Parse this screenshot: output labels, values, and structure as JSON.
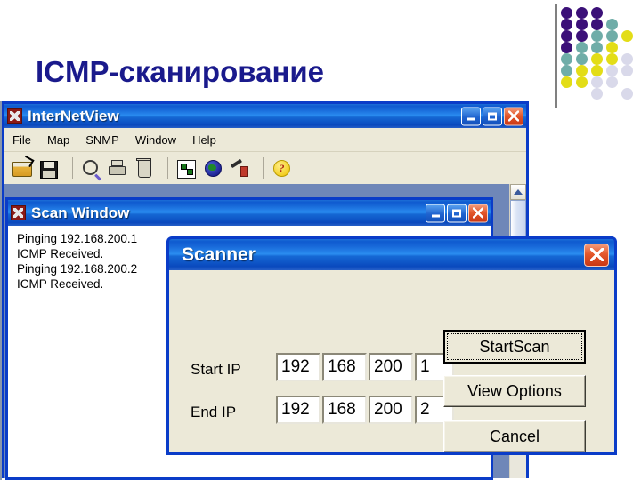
{
  "slide": {
    "title": "ICMP-сканирование",
    "title_color": "#1a1a8c"
  },
  "decoration": {
    "name": "dot-grid",
    "divider_color": "#808080",
    "colors": {
      "purple": "#3b1078",
      "teal": "#6fada8",
      "yellow": "#e3dd17",
      "lavender": "#d9d9ea"
    },
    "dots": [
      {
        "col": 0,
        "row": 0,
        "color": "#3b1078"
      },
      {
        "col": 1,
        "row": 0,
        "color": "#3b1078"
      },
      {
        "col": 2,
        "row": 0,
        "color": "#3b1078"
      },
      {
        "col": 0,
        "row": 1,
        "color": "#3b1078"
      },
      {
        "col": 1,
        "row": 1,
        "color": "#3b1078"
      },
      {
        "col": 2,
        "row": 1,
        "color": "#3b1078"
      },
      {
        "col": 3,
        "row": 1,
        "color": "#6fada8"
      },
      {
        "col": 0,
        "row": 2,
        "color": "#3b1078"
      },
      {
        "col": 1,
        "row": 2,
        "color": "#3b1078"
      },
      {
        "col": 2,
        "row": 2,
        "color": "#6fada8"
      },
      {
        "col": 3,
        "row": 2,
        "color": "#6fada8"
      },
      {
        "col": 4,
        "row": 2,
        "color": "#e3dd17"
      },
      {
        "col": 0,
        "row": 3,
        "color": "#3b1078"
      },
      {
        "col": 1,
        "row": 3,
        "color": "#6fada8"
      },
      {
        "col": 2,
        "row": 3,
        "color": "#6fada8"
      },
      {
        "col": 3,
        "row": 3,
        "color": "#e3dd17"
      },
      {
        "col": 0,
        "row": 4,
        "color": "#6fada8"
      },
      {
        "col": 1,
        "row": 4,
        "color": "#6fada8"
      },
      {
        "col": 2,
        "row": 4,
        "color": "#e3dd17"
      },
      {
        "col": 3,
        "row": 4,
        "color": "#e3dd17"
      },
      {
        "col": 4,
        "row": 4,
        "color": "#d9d9ea"
      },
      {
        "col": 0,
        "row": 5,
        "color": "#6fada8"
      },
      {
        "col": 1,
        "row": 5,
        "color": "#e3dd17"
      },
      {
        "col": 2,
        "row": 5,
        "color": "#e3dd17"
      },
      {
        "col": 3,
        "row": 5,
        "color": "#d9d9ea"
      },
      {
        "col": 4,
        "row": 5,
        "color": "#d9d9ea"
      },
      {
        "col": 0,
        "row": 6,
        "color": "#e3dd17"
      },
      {
        "col": 1,
        "row": 6,
        "color": "#e3dd17"
      },
      {
        "col": 2,
        "row": 6,
        "color": "#d9d9ea"
      },
      {
        "col": 3,
        "row": 6,
        "color": "#d9d9ea"
      },
      {
        "col": 2,
        "row": 7,
        "color": "#d9d9ea"
      },
      {
        "col": 4,
        "row": 7,
        "color": "#d9d9ea"
      }
    ]
  },
  "internetview": {
    "title": "InterNetView",
    "app_icon": "internetview-app-icon",
    "window_buttons": {
      "minimize": "minimize-button",
      "maximize": "maximize-button",
      "close": "close-button"
    },
    "menu": [
      {
        "label": "File"
      },
      {
        "label": "Map"
      },
      {
        "label": "SNMP"
      },
      {
        "label": "Window"
      },
      {
        "label": "Help"
      }
    ],
    "toolbar": [
      {
        "icon": "open-folder-icon",
        "tip": "Open"
      },
      {
        "icon": "save-disk-icon",
        "tip": "Save"
      },
      {
        "icon": "search-magnifier-icon",
        "tip": "Find"
      },
      {
        "icon": "print-icon",
        "tip": "Print"
      },
      {
        "icon": "delete-trash-icon",
        "tip": "Delete"
      },
      {
        "icon": "network-map-icon",
        "tip": "Map"
      },
      {
        "icon": "globe-icon",
        "tip": "Internet"
      },
      {
        "icon": "tools-icon",
        "tip": "Tools"
      },
      {
        "icon": "help-question-icon",
        "tip": "Help"
      }
    ],
    "scrollbar": {
      "up_arrow": "scroll-up-arrow"
    }
  },
  "scanwindow": {
    "title": "Scan Window",
    "app_icon": "scanwindow-app-icon",
    "log": [
      "Pinging 192.168.200.1",
      "ICMP Received.",
      "Pinging 192.168.200.2",
      "ICMP Received."
    ]
  },
  "scanner": {
    "title": "Scanner",
    "close_label": "close-button",
    "fields": [
      {
        "label": "Start IP",
        "octets": [
          "192",
          "168",
          "200",
          "1"
        ]
      },
      {
        "label": "End IP",
        "octets": [
          "192",
          "168",
          "200",
          "2"
        ]
      }
    ],
    "buttons": [
      {
        "label": "StartScan",
        "default": true
      },
      {
        "label": "View Options",
        "default": false
      },
      {
        "label": "Cancel",
        "default": false
      }
    ]
  }
}
